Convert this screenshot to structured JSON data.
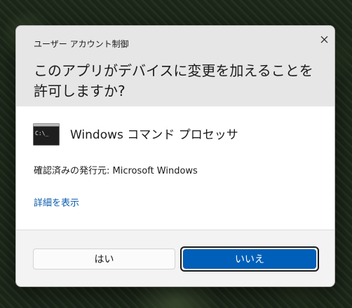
{
  "dialog": {
    "caption": "ユーザー アカウント制御",
    "question": "このアプリがデバイスに変更を加えることを許可しますか?",
    "close_icon": "close-icon",
    "app": {
      "icon": "command-prompt-icon",
      "icon_text": "C:\\_",
      "name": "Windows コマンド プロセッサ"
    },
    "publisher": "確認済みの発行元: Microsoft Windows",
    "details_link": "詳細を表示",
    "buttons": {
      "yes": "はい",
      "no": "いいえ"
    },
    "colors": {
      "header_bg": "#e6e6e6",
      "body_bg": "#ffffff",
      "footer_bg": "#f3f3f3",
      "accent": "#005fb8",
      "link": "#0b5cad"
    }
  }
}
